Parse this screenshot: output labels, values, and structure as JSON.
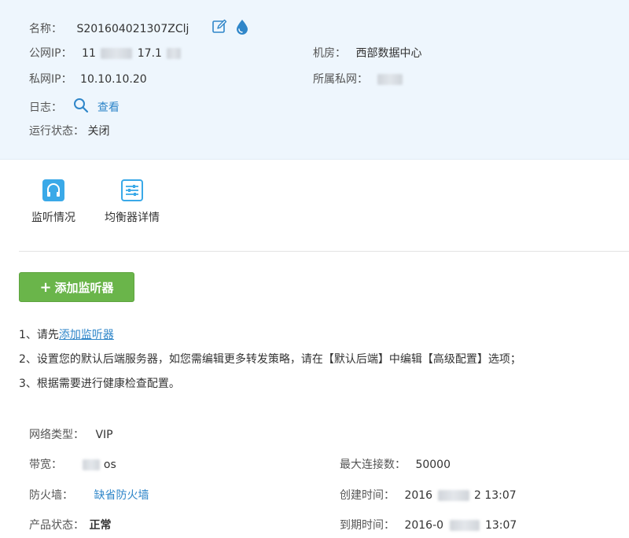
{
  "info": {
    "name_label": "名称：",
    "name_value": "S201604021307ZClj",
    "public_ip_label": "公网IP：",
    "public_ip_prefix": "11",
    "public_ip_suffix": "17.1",
    "private_ip_label": "私网IP：",
    "private_ip_value": "10.10.10.20",
    "log_label": "日志：",
    "log_view": "查看",
    "run_status_label": "运行状态：",
    "run_status_value": "关闭",
    "room_label": "机房：",
    "room_value": "西部数据中心",
    "subnet_label": "所属私网："
  },
  "tabs": [
    {
      "label": "监听情况",
      "icon": "headphones-icon"
    },
    {
      "label": "均衡器详情",
      "icon": "sliders-icon"
    }
  ],
  "add_button": {
    "label": "添加监听器"
  },
  "steps": {
    "s1_prefix": "1、请先",
    "s1_link": "添加监听器",
    "s2": "2、设置您的默认后端服务器，如您需编辑更多转发策略，请在【默认后端】中编辑【高级配置】选项；",
    "s3": "3、根据需要进行健康检查配置。"
  },
  "details": {
    "net_type_label": "网络类型：",
    "net_type_value": "VIP",
    "bandwidth_label": "带宽：",
    "bandwidth_suffix": "os",
    "max_conn_label": "最大连接数：",
    "max_conn_value": "50000",
    "firewall_label": "防火墙：",
    "firewall_value": "缺省防火墙",
    "created_label": "创建时间：",
    "created_prefix": "2016",
    "created_suffix": "2 13:07",
    "product_status_label": "产品状态：",
    "product_status_value": "正常",
    "expire_label": "到期时间：",
    "expire_prefix": "2016-0",
    "expire_suffix": "13:07"
  },
  "colors": {
    "panel_bg": "#eef6fd",
    "accent_blue": "#2f86c9",
    "button_green": "#6ab54a",
    "tab_icon_blue": "#3aa9e8"
  }
}
